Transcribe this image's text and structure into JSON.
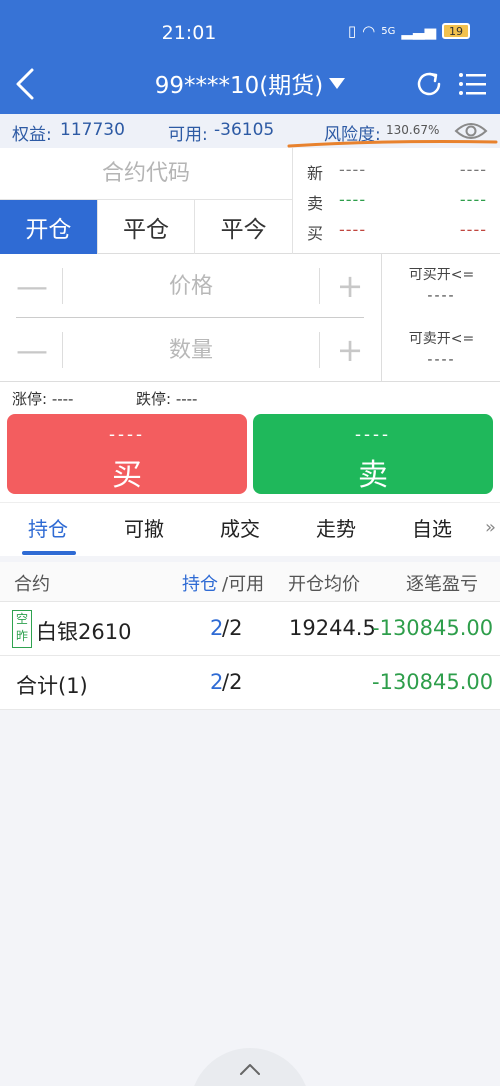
{
  "status": {
    "time": "21:01",
    "signal": "5G",
    "battery": "19"
  },
  "nav": {
    "title": "99****10(期货)"
  },
  "summary": {
    "equity_label": "权益:",
    "equity_value": "117730",
    "available_label": "可用:",
    "available_value": "-36105",
    "risk_label": "风险度:",
    "risk_value": "130.67%"
  },
  "order": {
    "code_placeholder": "合约代码",
    "tabs": [
      "开仓",
      "平仓",
      "平今"
    ],
    "price_placeholder": "价格",
    "qty_placeholder": "数量",
    "minus": "—",
    "plus": "+",
    "can_buy_label": "可买开<=",
    "can_buy_value": "----",
    "can_sell_label": "可卖开<=",
    "can_sell_value": "----"
  },
  "quote": [
    {
      "label": "新",
      "v1": "----",
      "v2": "----"
    },
    {
      "label": "卖",
      "v1": "----",
      "v2": "----"
    },
    {
      "label": "买",
      "v1": "----",
      "v2": "----"
    }
  ],
  "limits": {
    "up": "涨停: ----",
    "down": "跌停: ----"
  },
  "actions": {
    "buy_price": "----",
    "buy_label": "买",
    "sell_price": "----",
    "sell_label": "卖"
  },
  "bottom_tabs": [
    "持仓",
    "可撤",
    "成交",
    "走势",
    "自选"
  ],
  "table": {
    "headers": {
      "contract": "合约",
      "position": "持仓",
      "slash_available": "/可用",
      "avg_price": "开仓均价",
      "pnl": "逐笔盈亏"
    },
    "rows": [
      {
        "badge_top": "空",
        "badge_bottom": "昨",
        "contract": "白银2610",
        "position": "2",
        "available": "/2",
        "avg_price": "19244.5",
        "pnl": "-130845.00"
      }
    ],
    "total": {
      "label": "合计(1)",
      "position": "2",
      "available": "/2",
      "pnl": "-130845.00"
    }
  },
  "colors": {
    "header": "#3773d6",
    "buy": "#f35d5f",
    "sell": "#1fb85b",
    "accent": "#2f6bd4",
    "annotation": "#e8822e"
  }
}
